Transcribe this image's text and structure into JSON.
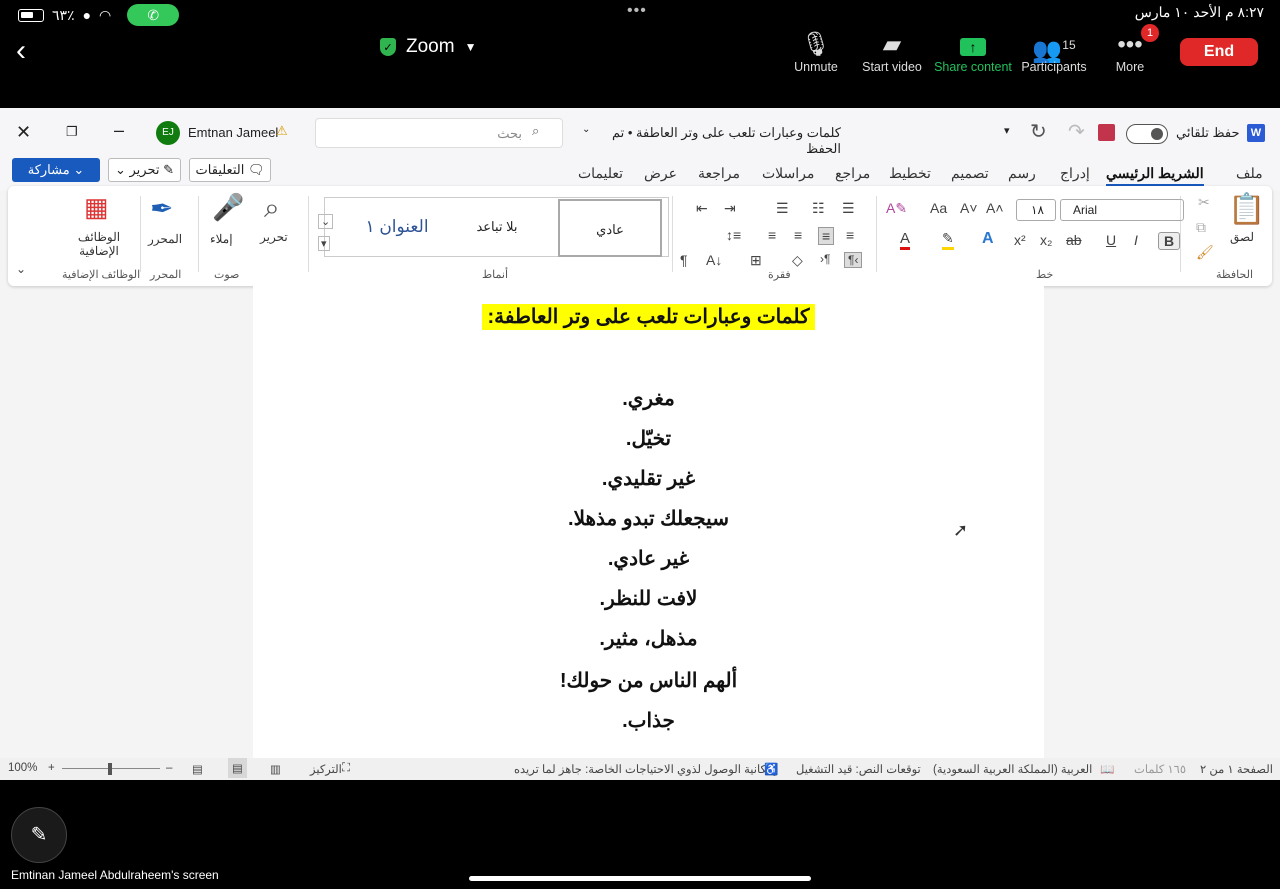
{
  "status_bar": {
    "battery": "٦٣٪",
    "time_date": "٨:٢٧ م  الأحد ١٠ مارس"
  },
  "zoom": {
    "title": "Zoom",
    "unmute": "Unmute",
    "start_video": "Start video",
    "share_content": "Share content",
    "participants": "Participants",
    "participants_count": "15",
    "more": "More",
    "more_badge": "1",
    "end": "End",
    "sharer_label": "Emtinan Jameel Abdulraheem's screen"
  },
  "word": {
    "doc_title": "كلمات وعبارات تلعب على وتر العاطفة • تم الحفظ",
    "autosave": "حفظ تلقائي",
    "search_placeholder": "بحث",
    "user_name": "Emtnan Jameel",
    "user_initials": "EJ",
    "tabs": [
      "ملف",
      "الشريط الرئيسي",
      "إدراج",
      "رسم",
      "تصميم",
      "تخطيط",
      "مراجع",
      "مراسلات",
      "مراجعة",
      "عرض",
      "تعليمات"
    ],
    "share_btn": "مشاركة",
    "edit_btn": "تحرير",
    "comments_btn": "التعليقات",
    "ribbon": {
      "paste": "لصق",
      "clipboard": "الحافظة",
      "font_name": "Arial",
      "font_size": "١٨",
      "font_group": "خط",
      "paragraph_group": "فقرة",
      "styles": [
        "عادي",
        "بلا تباعد",
        "العنوان ١"
      ],
      "styles_group": "أنماط",
      "editing": "تحرير",
      "dictate": "إملاء",
      "voice_group": "صوت",
      "editor": "المحرر",
      "editor_group": "المحرر",
      "addins": "الوظائف الإضافية",
      "addins_group": "الوظائف الإضافية"
    },
    "document": {
      "heading": "كلمات وعبارات تلعب على وتر العاطفة:",
      "lines": [
        "مغري.",
        "تخيّل.",
        "غير تقليدي.",
        "سيجعلك تبدو مذهلا.",
        "غير عادي.",
        "لافت للنظر.",
        "مذهل، مثير.",
        "ألهم الناس من حولك!",
        "جذاب."
      ]
    },
    "statusbar": {
      "page": "الصفحة ١ من ٢",
      "words": "١٦٥ كلمات",
      "language": "العربية (المملكة العربية السعودية)",
      "predictions": "توقعات النص: قيد التشغيل",
      "accessibility": "إمكانية الوصول لذوي الاحتياجات الخاصة: جاهز لما تريده",
      "focus": "التركيز",
      "zoom_level": "100%"
    }
  }
}
